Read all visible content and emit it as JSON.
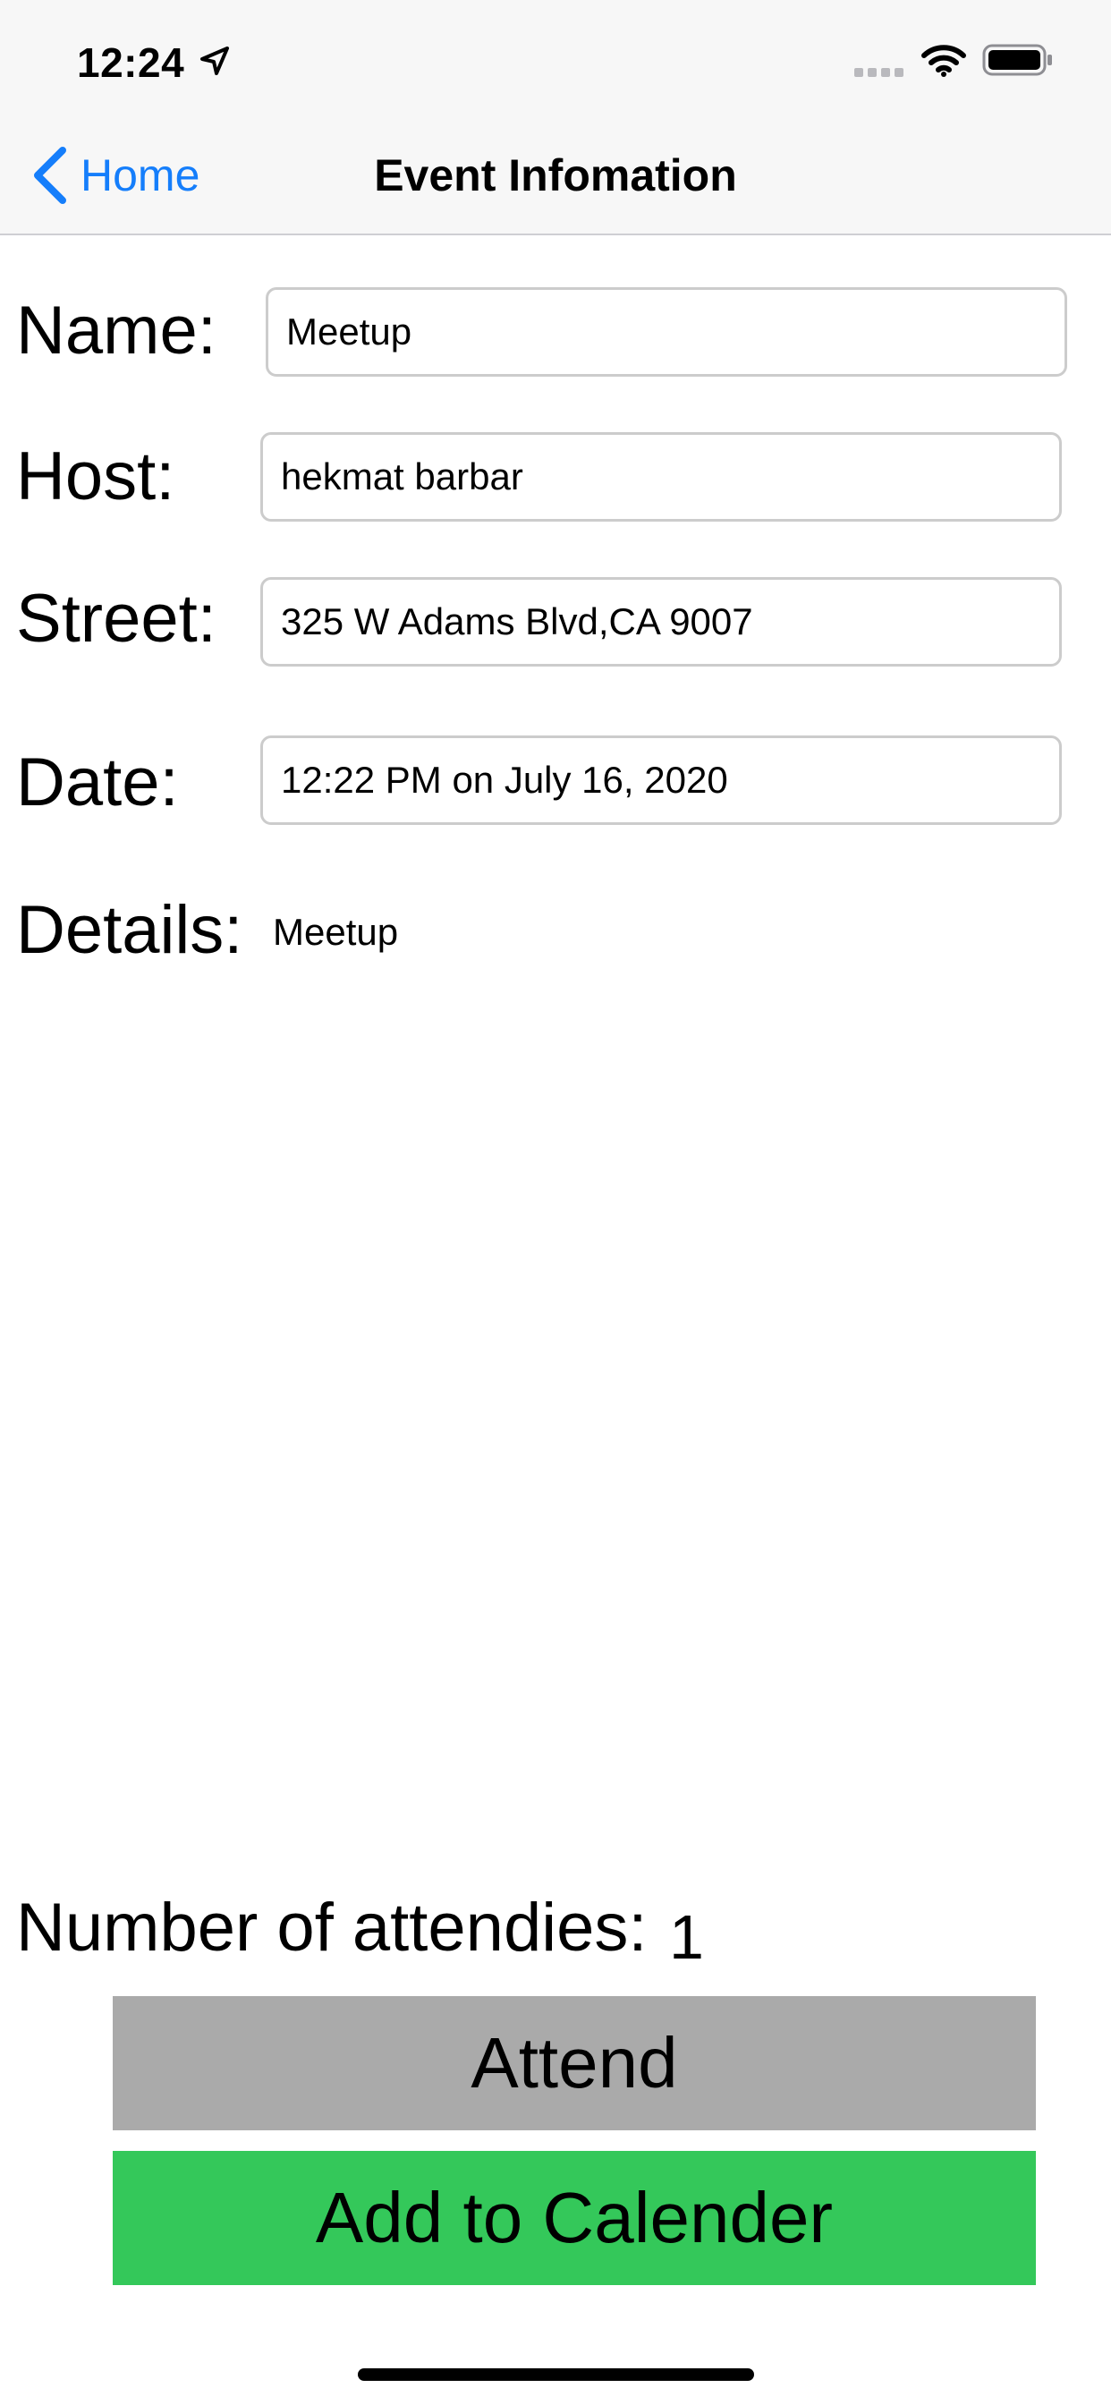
{
  "status_bar": {
    "time": "12:24",
    "icons": [
      "location-arrow-icon",
      "cellular-signal-icon",
      "wifi-icon",
      "battery-icon"
    ]
  },
  "nav": {
    "back_label": "Home",
    "title": "Event Infomation",
    "accent_color": "#157efb"
  },
  "form": {
    "name_label": "Name:",
    "name_value": "Meetup",
    "host_label": "Host:",
    "host_value": "hekmat barbar",
    "street_label": "Street:",
    "street_value": "325 W Adams Blvd,CA 9007",
    "date_label": "Date:",
    "date_value": "12:22 PM on July 16, 2020",
    "details_label": "Details:",
    "details_value": "Meetup"
  },
  "attendees": {
    "label": "Number of attendies:",
    "count": "1"
  },
  "buttons": {
    "attend_label": "Attend",
    "attend_color": "#aaaaaa",
    "calendar_label": "Add to Calender",
    "calendar_color": "#34c85a"
  }
}
